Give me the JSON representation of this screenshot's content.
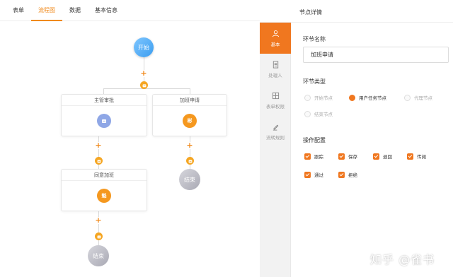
{
  "tabs": [
    {
      "label": "表单"
    },
    {
      "label": "流程图"
    },
    {
      "label": "数据"
    },
    {
      "label": "基本信息"
    }
  ],
  "flow": {
    "start_label": "开始",
    "node_approve": {
      "title": "主管审批"
    },
    "node_overtime": {
      "title": "加班申请",
      "icon_text": "彬"
    },
    "node_agree": {
      "title": "同意加班",
      "icon_text": "魁"
    },
    "end_label": "结束"
  },
  "panel": {
    "title": "节点详情",
    "nav": [
      {
        "label": "基本",
        "icon": "user-icon"
      },
      {
        "label": "处理人",
        "icon": "document-icon"
      },
      {
        "label": "表单权限",
        "icon": "grid-icon"
      },
      {
        "label": "流转规则",
        "icon": "pen-icon"
      }
    ],
    "node_name_label": "环节名称",
    "node_name_value": "加班申请",
    "node_type_label": "环节类型",
    "node_types": [
      {
        "label": "开始节点",
        "checked": false
      },
      {
        "label": "用户任务节点",
        "checked": true
      },
      {
        "label": "代理节点",
        "checked": false
      },
      {
        "label": "结束节点",
        "checked": false
      }
    ],
    "ops_label": "操作配置",
    "ops": [
      {
        "label": "跟踪"
      },
      {
        "label": "保存"
      },
      {
        "label": "退回"
      },
      {
        "label": "传阅"
      },
      {
        "label": "通过"
      },
      {
        "label": "拒绝"
      }
    ]
  },
  "watermark": "知乎 @雀书",
  "colors": {
    "accent": "#f0771f",
    "start_node": "#3a9df0",
    "end_node": "#a9a9b4"
  }
}
